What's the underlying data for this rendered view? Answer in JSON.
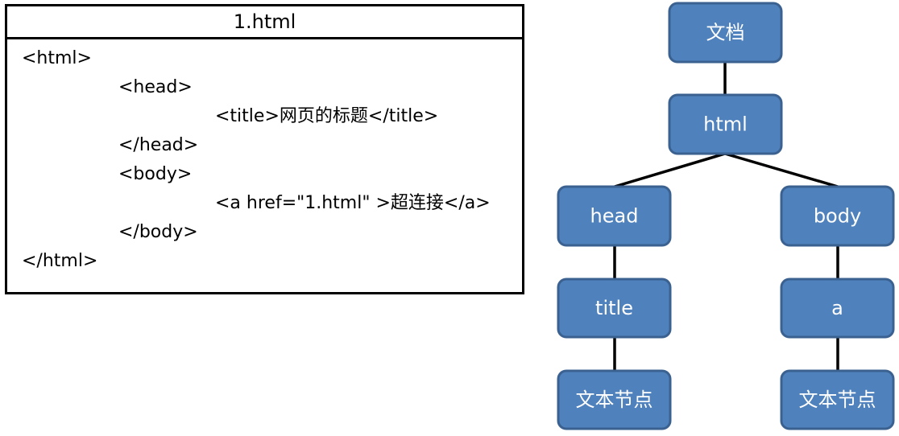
{
  "code_panel": {
    "title": "1.html",
    "lines": [
      "<html>",
      "<head>",
      "<title>网页的标题</title>",
      "</head>",
      "<body>",
      "<a href=\"1.html\" >超连接</a>",
      "</body>",
      "</html>"
    ]
  },
  "tree": {
    "root": "文档",
    "html": "html",
    "head": "head",
    "body": "body",
    "title": "title",
    "a": "a",
    "title_text_node": "文本节点",
    "a_text_node": "文本节点"
  },
  "colors": {
    "node_fill": "#4f81bd",
    "node_border": "#3a6190",
    "node_text": "#ffffff"
  }
}
